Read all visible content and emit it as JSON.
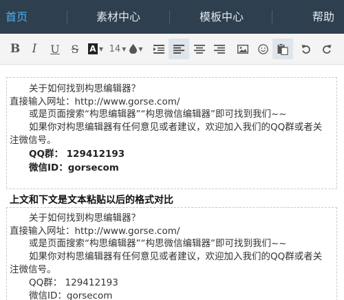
{
  "nav": {
    "items": [
      {
        "label": "首页",
        "active": true
      },
      {
        "label": "素材中心"
      },
      {
        "label": "模板中心"
      },
      {
        "label": "帮助"
      }
    ],
    "colors": {
      "bg": "#2e3f4f",
      "active": "#4fb0ef",
      "text": "#e3e8ee"
    }
  },
  "toolbar": {
    "bold": "B",
    "italic": "I",
    "underline": "U",
    "strike": "S",
    "font_color": "A",
    "font_size": "14",
    "icons": [
      "bold-icon",
      "italic-icon",
      "underline-icon",
      "strikethrough-icon",
      "font-color-icon",
      "font-size-dropdown",
      "background-color-icon",
      "indent-icon",
      "align-left-icon",
      "align-center-icon",
      "align-right-icon",
      "image-icon",
      "emoji-icon",
      "paste-icon",
      "undo-icon",
      "redo-icon"
    ],
    "active": [
      "align-left-icon",
      "paste-icon"
    ]
  },
  "editor": {
    "block1": {
      "line1": "关于如何找到构思编辑器？",
      "line2": "直接输入网址：http://www.gorse.com/",
      "line3": "或是页面搜索“构思编辑器”“构思微信编辑器”即可找到我们~~",
      "line4": "如果你对构思编辑器有任何意见或者建议，欢迎加入我们的QQ群或者关",
      "line5": "注微信号。",
      "qq": "QQ群： 129412193",
      "wechat": "微信ID：gorsecom"
    },
    "heading": "上文和下文是文本粘贴以后的格式对比",
    "block2": {
      "line1": "关于如何找到构思编辑器？",
      "line2": "直接输入网址：http://www.gorse.com/",
      "line3": "或是页面搜索“构思编辑器”“构思微信编辑器”即可找到我们~~",
      "line4": "如果你对构思编辑器有任何意见或者建议，欢迎加入我们的QQ群或者关",
      "line5": "注微信号。",
      "qq": "QQ群： 129412193",
      "wechat": "微信ID：gorsecom"
    }
  }
}
